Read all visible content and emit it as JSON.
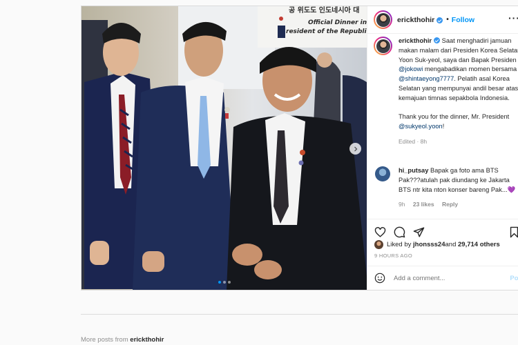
{
  "post": {
    "username": "erickthohir",
    "follow_label": "Follow",
    "photo_sign_lines": [
      "공 위도도 인도네시아 대",
      "Official Dinner in hon",
      "resident of the Republic of Indo"
    ],
    "caption": {
      "username": "erickthohir",
      "p1_a": " Saat menghadiri jamuan makan malam dari Presiden Korea Selatan Yoon Suk-yeol, saya dan Bapak Presiden ",
      "mention1": "@jokowi",
      "p1_b": " mengabadikan momen bersama ",
      "mention2": "@shintaeyong7777",
      "p1_c": ". Pelatih asal Korea Selatan yang mempunyai andil besar atas kemajuan timnas sepakbola Indonesia.",
      "p2_a": "Thank you for the dinner, Mr. President ",
      "mention3": "@sukyeol.yoon",
      "p2_b": "!",
      "edited": "Edited · 8h"
    },
    "comment": {
      "username": "hi_putsay",
      "text": " Bapak ga foto ama BTS Pak???atulah pak diundang ke Jakarta BTS ntr kita nton konser bareng Pak...💜",
      "time": "9h",
      "likes": "23 likes",
      "reply": "Reply"
    },
    "likes": {
      "prefix": "Liked by ",
      "user": "jhonsss24",
      "middle": " and ",
      "others": "29,714 others"
    },
    "time_ago": "9 HOURS AGO",
    "add_comment_placeholder": "Add a comment...",
    "post_button": "Post",
    "carousel": {
      "current": 1,
      "total": 3
    }
  },
  "more_posts": {
    "prefix": "More posts from ",
    "user": "erickthohir"
  }
}
